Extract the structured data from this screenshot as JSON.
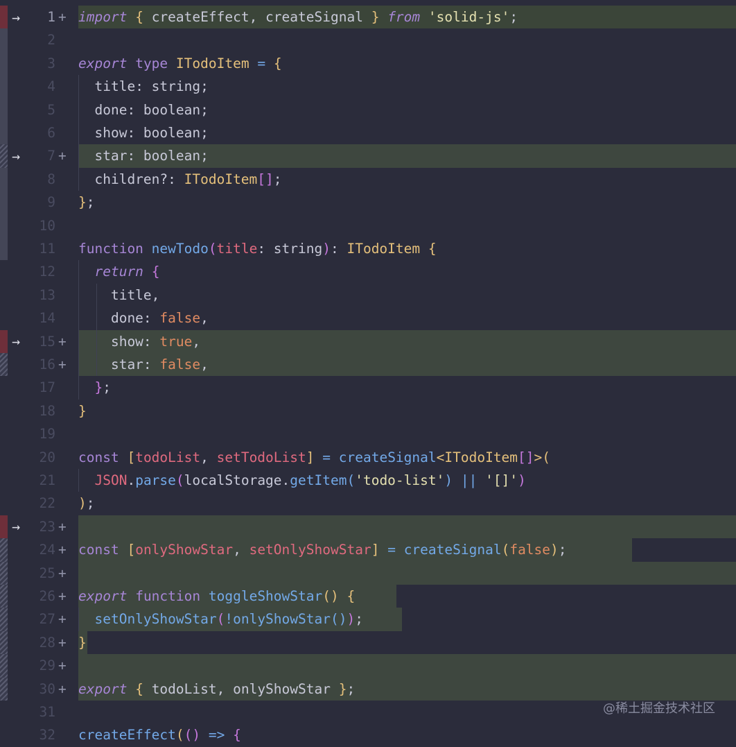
{
  "watermark": "@稀土掘金技术社区",
  "lines": [
    {
      "n": "1",
      "mark": "+",
      "arrow": true,
      "bar": "del",
      "bg": "line-hl",
      "bgx": [
        113,
        1062
      ],
      "tokens": [
        [
          "kw",
          "import"
        ],
        [
          "pu",
          " "
        ],
        [
          "br1",
          "{"
        ],
        [
          "pu",
          " createEffect, createSignal "
        ],
        [
          "br1",
          "}"
        ],
        [
          "pu",
          " "
        ],
        [
          "kw",
          "from"
        ],
        [
          "pu",
          " "
        ],
        [
          "str",
          "'solid-js'"
        ],
        [
          "pu",
          ";"
        ]
      ]
    },
    {
      "n": "2",
      "mark": "",
      "bar": "mod",
      "tokens": []
    },
    {
      "n": "3",
      "mark": "",
      "bar": "mod",
      "tokens": [
        [
          "kw",
          "export"
        ],
        [
          "pu",
          " "
        ],
        [
          "kw2",
          "type"
        ],
        [
          "pu",
          " "
        ],
        [
          "ty",
          "ITodoItem"
        ],
        [
          "pu",
          " "
        ],
        [
          "op",
          "="
        ],
        [
          "pu",
          " "
        ],
        [
          "br1",
          "{"
        ]
      ]
    },
    {
      "n": "4",
      "mark": "",
      "bar": "mod",
      "guides": [
        113
      ],
      "tokens": [
        [
          "prop",
          "  title"
        ],
        [
          "pu",
          ": string;"
        ]
      ]
    },
    {
      "n": "5",
      "mark": "",
      "bar": "mod",
      "guides": [
        113
      ],
      "tokens": [
        [
          "prop",
          "  done"
        ],
        [
          "pu",
          ": boolean;"
        ]
      ]
    },
    {
      "n": "6",
      "mark": "",
      "bar": "mod",
      "guides": [
        113
      ],
      "tokens": [
        [
          "prop",
          "  show"
        ],
        [
          "pu",
          ": boolean;"
        ]
      ]
    },
    {
      "n": "7",
      "mark": "+",
      "arrow": true,
      "bar": "add",
      "bg": "add-hl",
      "bgx": [
        113,
        1062
      ],
      "guides": [
        113
      ],
      "tokens": [
        [
          "prop",
          "  star"
        ],
        [
          "pu",
          ": boolean;"
        ]
      ]
    },
    {
      "n": "8",
      "mark": "",
      "bar": "mod",
      "guides": [
        113
      ],
      "tokens": [
        [
          "prop",
          "  children?"
        ],
        [
          "pu",
          ": "
        ],
        [
          "ty",
          "ITodoItem"
        ],
        [
          "br2",
          "[]"
        ],
        [
          "pu",
          ";"
        ]
      ]
    },
    {
      "n": "9",
      "mark": "",
      "bar": "mod",
      "tokens": [
        [
          "br1",
          "}"
        ],
        [
          "pu",
          ";"
        ]
      ]
    },
    {
      "n": "10",
      "mark": "",
      "bar": "mod",
      "tokens": []
    },
    {
      "n": "11",
      "mark": "",
      "bar": "mod",
      "tokens": [
        [
          "kw2",
          "function"
        ],
        [
          "pu",
          " "
        ],
        [
          "fn",
          "newTodo"
        ],
        [
          "br2",
          "("
        ],
        [
          "var",
          "title"
        ],
        [
          "pu",
          ": string"
        ],
        [
          "br2",
          ")"
        ],
        [
          "pu",
          ": "
        ],
        [
          "ty",
          "ITodoItem"
        ],
        [
          "pu",
          " "
        ],
        [
          "br1",
          "{"
        ]
      ]
    },
    {
      "n": "12",
      "mark": "",
      "guides": [
        113
      ],
      "tokens": [
        [
          "pu",
          "  "
        ],
        [
          "kw",
          "return"
        ],
        [
          "pu",
          " "
        ],
        [
          "br2",
          "{"
        ]
      ]
    },
    {
      "n": "13",
      "mark": "",
      "guides": [
        113,
        139
      ],
      "tokens": [
        [
          "prop",
          "    title"
        ],
        [
          "pu",
          ","
        ]
      ]
    },
    {
      "n": "14",
      "mark": "",
      "guides": [
        113,
        139
      ],
      "tokens": [
        [
          "prop",
          "    done"
        ],
        [
          "pu",
          ": "
        ],
        [
          "bool",
          "false"
        ],
        [
          "pu",
          ","
        ]
      ]
    },
    {
      "n": "15",
      "mark": "+",
      "arrow": true,
      "bar": "del",
      "bg": "add-hl",
      "bgx": [
        113,
        1062
      ],
      "guides": [
        113,
        139
      ],
      "tokens": [
        [
          "prop",
          "    show"
        ],
        [
          "pu",
          ": "
        ],
        [
          "bool",
          "true"
        ],
        [
          "pu",
          ","
        ]
      ]
    },
    {
      "n": "16",
      "mark": "+",
      "bar": "add",
      "bg": "add-hl",
      "bgx": [
        113,
        1062
      ],
      "guides": [
        113,
        139
      ],
      "tokens": [
        [
          "prop",
          "    star"
        ],
        [
          "pu",
          ": "
        ],
        [
          "bool",
          "false"
        ],
        [
          "pu",
          ","
        ]
      ]
    },
    {
      "n": "17",
      "mark": "",
      "guides": [
        113
      ],
      "tokens": [
        [
          "pu",
          "  "
        ],
        [
          "br2",
          "}"
        ],
        [
          "pu",
          ";"
        ]
      ]
    },
    {
      "n": "18",
      "mark": "",
      "tokens": [
        [
          "br1",
          "}"
        ]
      ]
    },
    {
      "n": "19",
      "mark": "",
      "tokens": []
    },
    {
      "n": "20",
      "mark": "",
      "tokens": [
        [
          "kw2",
          "const"
        ],
        [
          "pu",
          " "
        ],
        [
          "br1",
          "["
        ],
        [
          "var",
          "todoList"
        ],
        [
          "pu",
          ", "
        ],
        [
          "var",
          "setTodoList"
        ],
        [
          "br1",
          "]"
        ],
        [
          "pu",
          " "
        ],
        [
          "op",
          "="
        ],
        [
          "pu",
          " "
        ],
        [
          "fn",
          "createSignal"
        ],
        [
          "ty",
          "<ITodoItem"
        ],
        [
          "br2",
          "[]"
        ],
        [
          "ty",
          ">"
        ],
        [
          "br1",
          "("
        ]
      ]
    },
    {
      "n": "21",
      "mark": "",
      "guides": [
        113
      ],
      "tokens": [
        [
          "pu",
          "  "
        ],
        [
          "var",
          "JSON"
        ],
        [
          "pu",
          "."
        ],
        [
          "fn",
          "parse"
        ],
        [
          "br2",
          "("
        ],
        [
          "pu",
          "localStorage."
        ],
        [
          "fn",
          "getItem"
        ],
        [
          "br3",
          "("
        ],
        [
          "str",
          "'todo-list'"
        ],
        [
          "br3",
          ")"
        ],
        [
          "pu",
          " "
        ],
        [
          "op",
          "||"
        ],
        [
          "pu",
          " "
        ],
        [
          "str",
          "'[]'"
        ],
        [
          "br2",
          ")"
        ]
      ]
    },
    {
      "n": "22",
      "mark": "",
      "tokens": [
        [
          "br1",
          ")"
        ],
        [
          "pu",
          ";"
        ]
      ]
    },
    {
      "n": "23",
      "mark": "+",
      "arrow": true,
      "bar": "del",
      "bg": "add-hl",
      "bgx": [
        113,
        1062
      ],
      "tokens": []
    },
    {
      "n": "24",
      "mark": "+",
      "bar": "add",
      "bg": "add-hl",
      "bgx": [
        113,
        912
      ],
      "tokens": [
        [
          "kw2",
          "const"
        ],
        [
          "pu",
          " "
        ],
        [
          "br1",
          "["
        ],
        [
          "var",
          "onlyShowStar"
        ],
        [
          "pu",
          ", "
        ],
        [
          "var",
          "setOnlyShowStar"
        ],
        [
          "br1",
          "]"
        ],
        [
          "pu",
          " "
        ],
        [
          "op",
          "="
        ],
        [
          "pu",
          " "
        ],
        [
          "fn",
          "createSignal"
        ],
        [
          "br1",
          "("
        ],
        [
          "bool",
          "false"
        ],
        [
          "br1",
          ")"
        ],
        [
          "pu",
          ";"
        ]
      ]
    },
    {
      "n": "25",
      "mark": "+",
      "bar": "add",
      "bg": "add-hl",
      "bgx": [
        113,
        1062
      ],
      "tokens": []
    },
    {
      "n": "26",
      "mark": "+",
      "bar": "add",
      "bg": "add-hl",
      "bgx": [
        113,
        572
      ],
      "tokens": [
        [
          "kw",
          "export"
        ],
        [
          "pu",
          " "
        ],
        [
          "kw2",
          "function"
        ],
        [
          "pu",
          " "
        ],
        [
          "fn",
          "toggleShowStar"
        ],
        [
          "br1",
          "()"
        ],
        [
          "pu",
          " "
        ],
        [
          "br1",
          "{"
        ]
      ]
    },
    {
      "n": "27",
      "mark": "+",
      "bar": "add",
      "bg": "add-hl",
      "bgx": [
        113,
        580
      ],
      "guides": [
        113
      ],
      "tokens": [
        [
          "pu",
          "  "
        ],
        [
          "fn",
          "setOnlyShowStar"
        ],
        [
          "br2",
          "("
        ],
        [
          "op",
          "!"
        ],
        [
          "fn",
          "onlyShowStar"
        ],
        [
          "br3",
          "()"
        ],
        [
          "br2",
          ")"
        ],
        [
          "pu",
          ";"
        ]
      ]
    },
    {
      "n": "28",
      "mark": "+",
      "bar": "add",
      "bg": "add-hl",
      "bgx": [
        113,
        126
      ],
      "tokens": [
        [
          "br1",
          "}"
        ]
      ]
    },
    {
      "n": "29",
      "mark": "+",
      "bar": "add",
      "bg": "add-hl",
      "bgx": [
        113,
        1062
      ],
      "tokens": []
    },
    {
      "n": "30",
      "mark": "+",
      "bar": "add",
      "bg": "add-hl",
      "bgx": [
        113,
        1062
      ],
      "tokens": [
        [
          "kw",
          "export"
        ],
        [
          "pu",
          " "
        ],
        [
          "br1",
          "{"
        ],
        [
          "pu",
          " todoList, onlyShowStar "
        ],
        [
          "br1",
          "}"
        ],
        [
          "pu",
          ";"
        ]
      ]
    },
    {
      "n": "31",
      "mark": "",
      "tokens": []
    },
    {
      "n": "32",
      "mark": "",
      "tokens": [
        [
          "fn",
          "createEffect"
        ],
        [
          "br1",
          "("
        ],
        [
          "br2",
          "()"
        ],
        [
          "pu",
          " "
        ],
        [
          "op",
          "=>"
        ],
        [
          "pu",
          " "
        ],
        [
          "br2",
          "{"
        ]
      ]
    }
  ]
}
